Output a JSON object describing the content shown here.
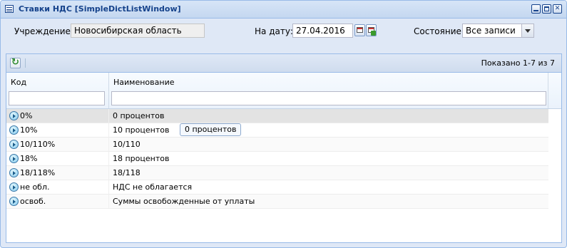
{
  "window": {
    "title": "Ставки НДС [SimpleDictListWindow]"
  },
  "filters": {
    "institution_label": "Учреждение:",
    "institution_value": "Новосибирская область",
    "date_label": "На дату:",
    "date_value": "27.04.2016",
    "state_label": "Состояние:",
    "state_value": "Все записи"
  },
  "grid": {
    "paging_text": "Показано 1-7 из 7",
    "columns": [
      {
        "label": "Код"
      },
      {
        "label": "Наименование"
      }
    ],
    "rows": [
      {
        "code": "0%",
        "name": "0 процентов"
      },
      {
        "code": "10%",
        "name": "10 процентов"
      },
      {
        "code": "10/110%",
        "name": "10/110"
      },
      {
        "code": "18%",
        "name": "18 процентов"
      },
      {
        "code": "18/118%",
        "name": "18/118"
      },
      {
        "code": "не обл.",
        "name": "НДС не облагается"
      },
      {
        "code": "освоб.",
        "name": "Суммы освобожденные от уплаты"
      }
    ],
    "tooltip": "0 процентов"
  }
}
